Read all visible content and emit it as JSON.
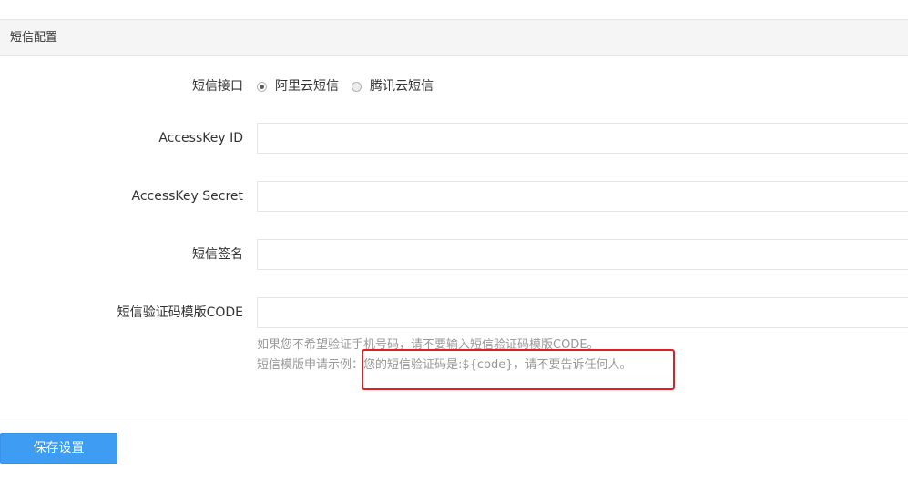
{
  "panel": {
    "title": "短信配置"
  },
  "form": {
    "provider": {
      "label": "短信接口",
      "options": [
        {
          "label": "阿里云短信",
          "checked": true
        },
        {
          "label": "腾讯云短信",
          "checked": false
        }
      ]
    },
    "access_key_id": {
      "label": "AccessKey ID",
      "value": ""
    },
    "access_key_secret": {
      "label": "AccessKey Secret",
      "value": ""
    },
    "sign_name": {
      "label": "短信签名",
      "value": ""
    },
    "template_code": {
      "label": "短信验证码模版CODE",
      "value": ""
    },
    "help": {
      "line1": "如果您不希望验证手机号码，请不要输入短信验证码模版CODE。",
      "line2": "短信模版申请示例：您的短信验证码是:${code}，请不要告诉任何人。"
    }
  },
  "actions": {
    "save_label": "保存设置"
  },
  "colors": {
    "primary_button": "#3f9cf3",
    "highlight_border": "#e02020",
    "header_bg": "#f5f5f5"
  }
}
